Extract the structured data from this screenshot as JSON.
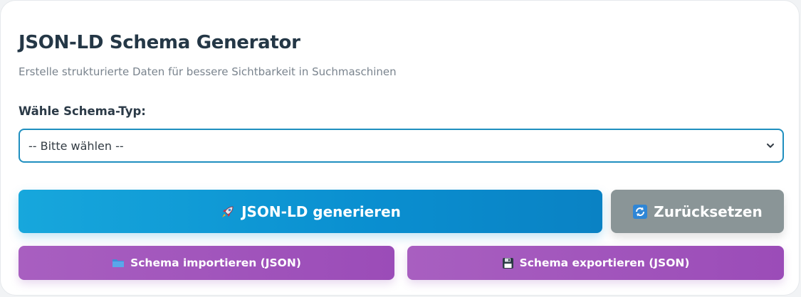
{
  "header": {
    "title": "JSON-LD Schema Generator",
    "subtitle": "Erstelle strukturierte Daten für bessere Sichtbarkeit in Suchmaschinen"
  },
  "schema_select": {
    "label": "Wähle Schema-Typ:",
    "selected_value": "-- Bitte wählen --",
    "icon": "chevron-down-icon"
  },
  "actions": {
    "generate_label": "JSON-LD generieren",
    "generate_icon": "rocket-icon",
    "reset_label": "Zurücksetzen",
    "reset_icon": "refresh-icon",
    "import_label": "Schema importieren (JSON)",
    "import_icon": "folder-icon",
    "export_label": "Schema exportieren (JSON)",
    "export_icon": "floppy-disk-icon"
  },
  "colors": {
    "accent_blue": "#0a8fd0",
    "select_border": "#1f8fbf",
    "reset_gray": "#8a9597",
    "purple": "#9b4cb8",
    "title": "#243746"
  }
}
